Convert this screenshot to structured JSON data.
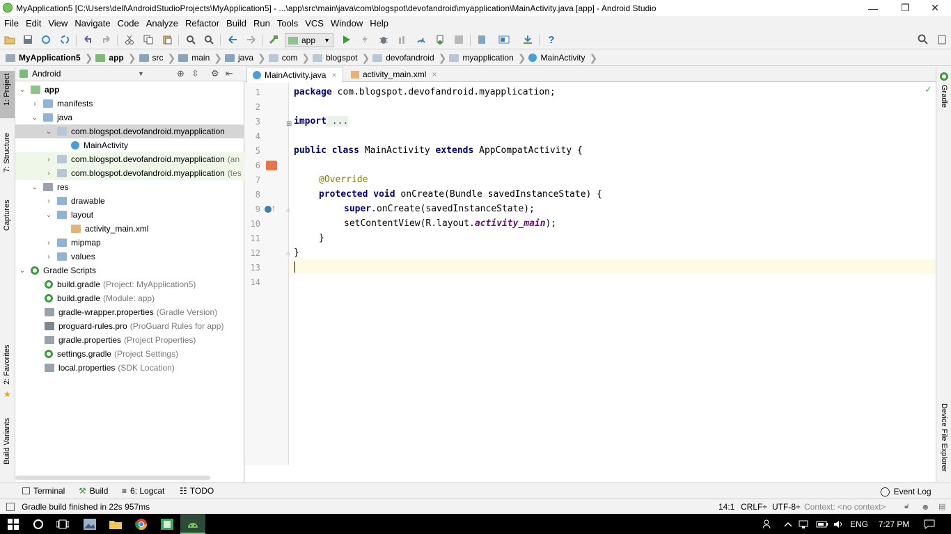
{
  "window": {
    "title": "MyApplication5 [C:\\Users\\dell\\AndroidStudioProjects\\MyApplication5] - ...\\app\\src\\main\\java\\com\\blogspot\\devofandroid\\myapplication\\MainActivity.java [app] - Android Studio",
    "minimize": "—",
    "restore": "❐",
    "close": "✕"
  },
  "menu": [
    "File",
    "Edit",
    "View",
    "Navigate",
    "Code",
    "Analyze",
    "Refactor",
    "Build",
    "Run",
    "Tools",
    "VCS",
    "Window",
    "Help"
  ],
  "toolbar": {
    "run_config": "app",
    "help": "?"
  },
  "breadcrumbs": [
    {
      "label": "MyApplication5",
      "bold": true
    },
    {
      "label": "app",
      "bold": true
    },
    {
      "label": "src"
    },
    {
      "label": "main"
    },
    {
      "label": "java"
    },
    {
      "label": "com"
    },
    {
      "label": "blogspot"
    },
    {
      "label": "devofandroid"
    },
    {
      "label": "myapplication"
    },
    {
      "label": "MainActivity"
    }
  ],
  "left_tool_tabs": [
    "1: Project",
    "7: Structure",
    "Captures",
    "2: Favorites",
    "Build Variants"
  ],
  "right_tool_tabs": [
    "Gradle",
    "Device File Explorer"
  ],
  "project_panel": {
    "view_selector": "Android",
    "tree": [
      {
        "label": "app",
        "bold": true
      },
      {
        "label": "manifests"
      },
      {
        "label": "java"
      },
      {
        "label": "com.blogspot.devofandroid.myapplication"
      },
      {
        "label": "MainActivity"
      },
      {
        "label": "com.blogspot.devofandroid.myapplication",
        "hint": "(an"
      },
      {
        "label": "com.blogspot.devofandroid.myapplication",
        "hint": "(tes"
      },
      {
        "label": "res"
      },
      {
        "label": "drawable"
      },
      {
        "label": "layout"
      },
      {
        "label": "activity_main.xml"
      },
      {
        "label": "mipmap"
      },
      {
        "label": "values"
      },
      {
        "label": "Gradle Scripts"
      },
      {
        "label": "build.gradle",
        "hint": "(Project: MyApplication5)"
      },
      {
        "label": "build.gradle",
        "hint": "(Module: app)"
      },
      {
        "label": "gradle-wrapper.properties",
        "hint": "(Gradle Version)"
      },
      {
        "label": "proguard-rules.pro",
        "hint": "(ProGuard Rules for app)"
      },
      {
        "label": "gradle.properties",
        "hint": "(Project Properties)"
      },
      {
        "label": "settings.gradle",
        "hint": "(Project Settings)"
      },
      {
        "label": "local.properties",
        "hint": "(SDK Location)"
      }
    ]
  },
  "editor_tabs": [
    {
      "label": "MainActivity.java",
      "close": "×"
    },
    {
      "label": "activity_main.xml",
      "close": "×"
    }
  ],
  "code": {
    "line_numbers": [
      "1",
      "2",
      "3",
      "4",
      "5",
      "6",
      "7",
      "8",
      "9",
      "10",
      "11",
      "12",
      "13",
      "14"
    ],
    "l1_kw": "package",
    "l1_rest": " com.blogspot.devofandroid.myapplication;",
    "l3_kw": "import",
    "l3_fold": " ...",
    "l6_kw1": "public",
    "l6_kw2": "class",
    "l6_mid": " MainActivity ",
    "l6_kw3": "extends",
    "l6_rest": " AppCompatActivity {",
    "l8_ann": "@Override",
    "l9_kw1": "protected",
    "l9_kw2": "void",
    "l9_rest": " onCreate(Bundle savedInstanceState) {",
    "l10_kw": "super",
    "l10_rest": ".onCreate(savedInstanceState);",
    "l11_pre": "setContentView(R.layout.",
    "l11_ital": "activity_main",
    "l11_post": ");",
    "l12": "}",
    "l13": "}"
  },
  "bottom_tabs": [
    "Terminal",
    "Build",
    "6: Logcat",
    "TODO",
    "Event Log"
  ],
  "status": {
    "message": "Gradle build finished in 22s 957ms",
    "position": "14:1",
    "line_sep": "CRLF÷",
    "encoding": "UTF-8÷",
    "context": "Context: <no context>"
  },
  "taskbar": {
    "lang": "ENG",
    "time": "7:27 PM"
  }
}
